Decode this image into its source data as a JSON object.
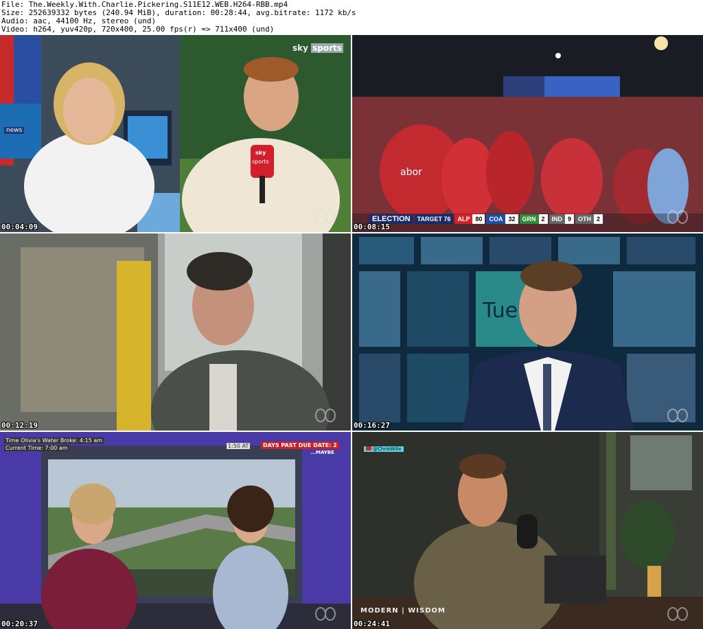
{
  "header": {
    "file": "File: The.Weekly.With.Charlie.Pickering.S11E12.WEB.H264-RBB.mp4",
    "size": "Size: 252639332 bytes (240.94 MiB), duration: 00:28:44, avg.bitrate: 1172 kb/s",
    "audio": "Audio: aac, 44100 Hz, stereo (und)",
    "video": "Video: h264, yuv420p, 720x400, 25.00 fps(r) => 711x400 (und)"
  },
  "tiles": [
    {
      "timestamp": "00:04:09",
      "overlay": {
        "sky_logo": "sky",
        "sky_sports": "sports",
        "news_badge": "news",
        "mic_sky": "sky",
        "mic_sports": "sports"
      }
    },
    {
      "timestamp": "00:08:15",
      "overlay": {
        "shirt": "abor",
        "election": "ELECTION",
        "target": "TARGET 76",
        "results": [
          {
            "party": "ALP",
            "seats": "80",
            "color": "#d8202a"
          },
          {
            "party": "COA",
            "seats": "32",
            "color": "#1d4fa3"
          },
          {
            "party": "GRN",
            "seats": "2",
            "color": "#2e8b3a"
          },
          {
            "party": "IND",
            "seats": "9",
            "color": "#666666"
          },
          {
            "party": "OTH",
            "seats": "2",
            "color": "#666666"
          }
        ]
      }
    },
    {
      "timestamp": "00:12:19"
    },
    {
      "timestamp": "00:16:27",
      "overlay": {
        "screen_text": "Tue"
      }
    },
    {
      "timestamp": "00:20:37",
      "overlay": {
        "water_broke": "Time Olivia's Water Broke: 4:15 am",
        "current_time": "Current Time: 7:00 am",
        "clock": "1:50 AT",
        "days_past": "DAYS PAST DUE DATE: 2",
        "maybe": "...MAYBE"
      }
    },
    {
      "timestamp": "00:24:41",
      "overlay": {
        "handle": "@ChrisWillx",
        "brand": "MODERN | WISDOM"
      }
    }
  ]
}
